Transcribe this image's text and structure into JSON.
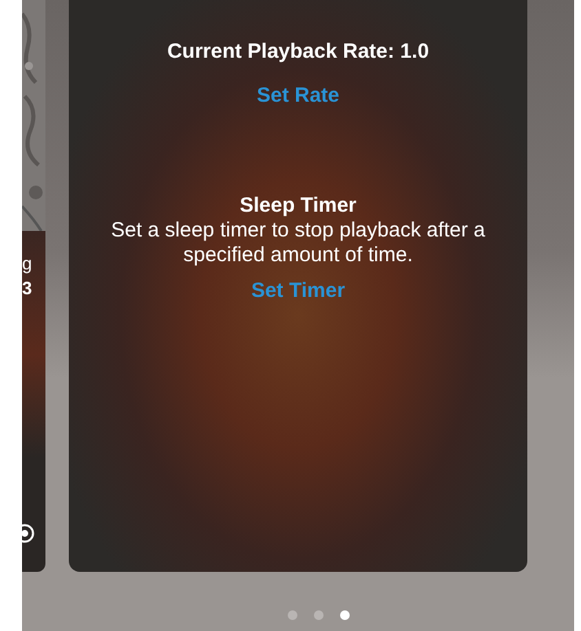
{
  "side_card": {
    "texts": [
      "g",
      "3"
    ]
  },
  "card": {
    "rate_label": "Current Playback Rate: 1.0",
    "rate_button": "Set Rate",
    "timer_title": "Sleep Timer",
    "timer_description": "Set a sleep timer to stop playback after a specified amount of time.",
    "timer_button": "Set Timer"
  },
  "page_dots": [
    {
      "selected": false
    },
    {
      "selected": false
    },
    {
      "selected": true
    }
  ]
}
